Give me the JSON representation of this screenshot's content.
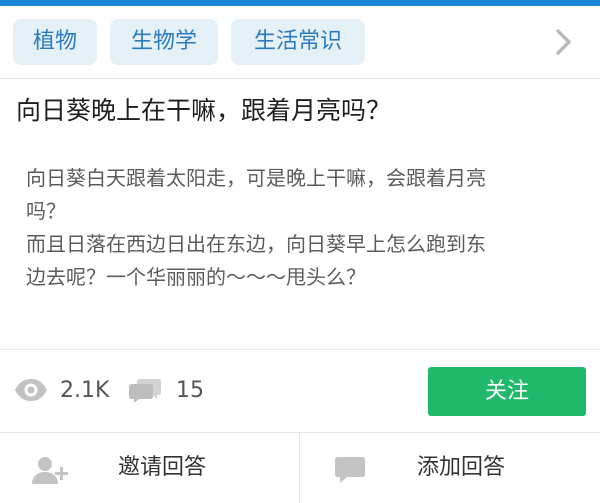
{
  "header": {
    "accent_color": "#1a86d8"
  },
  "tags": [
    {
      "label": "植物"
    },
    {
      "label": "生物学"
    },
    {
      "label": "生活常识"
    }
  ],
  "question": {
    "title": "向日葵晚上在干嘛，跟着月亮吗？",
    "body_lines": [
      "向日葵白天跟着太阳走，可是晚上干嘛，会跟着月亮",
      "吗？",
      "而且日落在西边日出在东边，向日葵早上怎么跑到东",
      "边去呢？一个华丽丽的～～～甩头么？"
    ]
  },
  "stats": {
    "views": "2.1K",
    "answers": "15"
  },
  "actions": {
    "follow_label": "关注",
    "follow_color": "#20b86a",
    "invite_label": "邀请回答",
    "add_answer_label": "添加回答"
  },
  "icons": {
    "chevron": "chevron-right-icon",
    "views": "eye-icon",
    "answers": "comment-bubbles-icon",
    "invite": "add-user-icon",
    "add_answer": "comment-icon"
  }
}
